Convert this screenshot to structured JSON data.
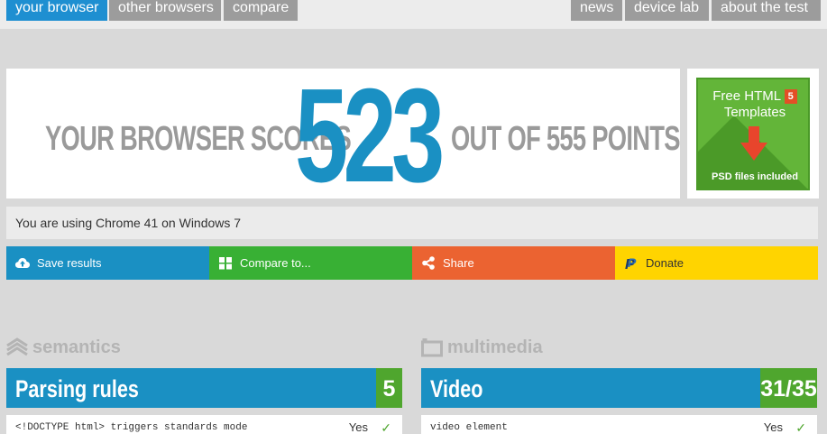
{
  "nav": {
    "left": [
      {
        "label": "your browser",
        "active": true
      },
      {
        "label": "other browsers",
        "active": false
      },
      {
        "label": "compare",
        "active": false
      }
    ],
    "right": [
      {
        "label": "news"
      },
      {
        "label": "device lab"
      },
      {
        "label": "about the test"
      }
    ]
  },
  "score": {
    "prefix": "YOUR BROWSER SCORES",
    "value": "523",
    "suffix": "OUT OF 555 POINTS"
  },
  "ad": {
    "title": "Free HTML",
    "title2": "Templates",
    "badge": "5",
    "footer": "PSD files included"
  },
  "using": "You are using Chrome 41 on Windows 7",
  "actions": [
    {
      "label": "Save results",
      "icon": "cloud-upload-icon",
      "color": "#1a90c3"
    },
    {
      "label": "Compare to...",
      "icon": "grid-icon",
      "color": "#38b034"
    },
    {
      "label": "Share",
      "icon": "share-icon",
      "color": "#eb6331"
    },
    {
      "label": "Donate",
      "icon": "paypal-icon",
      "color": "#ffd400"
    }
  ],
  "sections": [
    {
      "label": "semantics",
      "icon": "layers-icon"
    },
    {
      "label": "multimedia",
      "icon": "film-icon"
    }
  ],
  "cards": [
    {
      "title": "Parsing rules",
      "points": "5",
      "row_label": "<!DOCTYPE html> triggers standards mode",
      "row_value": "Yes"
    },
    {
      "title": "Video",
      "points": "31/35",
      "row_label": "video element",
      "row_value": "Yes"
    }
  ],
  "colors": {
    "accent_blue": "#1a90c3",
    "tab_active": "#1e8fd1",
    "tab_inactive": "#9c9c9c",
    "green": "#4fa62e",
    "orange": "#eb6331",
    "yellow": "#ffd400"
  }
}
